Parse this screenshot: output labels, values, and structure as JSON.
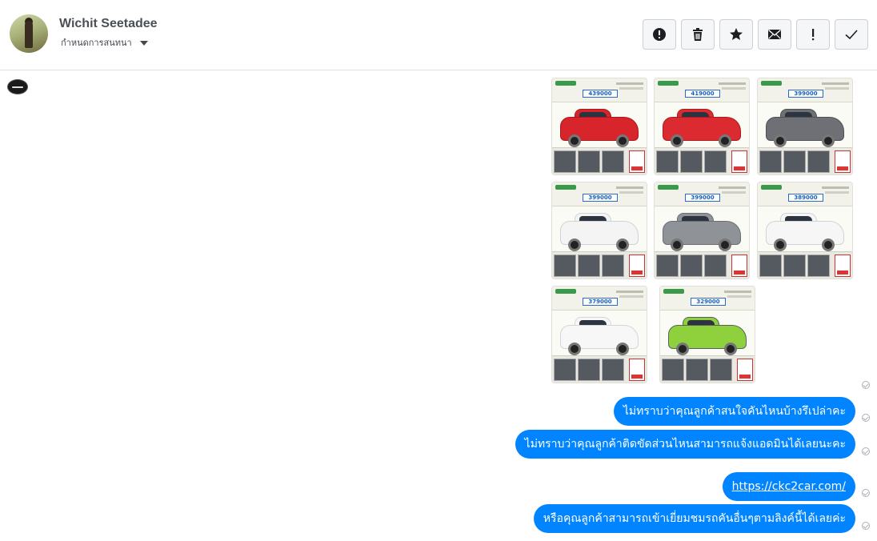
{
  "header": {
    "contact_name": "Wichit Seetadee",
    "subtitle": "กำหนดการสนทนา",
    "actions": [
      {
        "name": "report-icon",
        "label": "report"
      },
      {
        "name": "trash-icon",
        "label": "delete"
      },
      {
        "name": "star-icon",
        "label": "star"
      },
      {
        "name": "envelope-icon",
        "label": "mark unread"
      },
      {
        "name": "exclamation-icon",
        "label": "spam"
      },
      {
        "name": "checkmark-icon",
        "label": "done"
      }
    ]
  },
  "gallery": {
    "cards": [
      {
        "price": "439000",
        "color": "#d8242b",
        "accent": "#a8181d"
      },
      {
        "price": "419000",
        "color": "#db2b30",
        "accent": "#a81c20"
      },
      {
        "price": "399000",
        "color": "#6e7075",
        "accent": "#4e5055"
      },
      {
        "price": "399000",
        "color": "#f4f4f4",
        "accent": "#cfd2d6"
      },
      {
        "price": "399000",
        "color": "#8f9296",
        "accent": "#6a6d71"
      },
      {
        "price": "389000",
        "color": "#f6f6f6",
        "accent": "#d0d3d7"
      },
      {
        "price": "379000",
        "color": "#f7f7f7",
        "accent": "#d3d6da"
      },
      {
        "price": "329000",
        "color": "#8ed13c",
        "accent": "#5a5f63"
      }
    ]
  },
  "messages": [
    {
      "text": "ไม่ทราบว่าคุณลูกค้าสนใจคันไหนบ้างรึเปล่าคะ"
    },
    {
      "text": "ไม่ทราบว่าคุณลูกค้าติดขัดส่วนไหนสามารถแจ้งแอดมินได้เลยนะคะ"
    },
    {
      "text": "https://ckc2car.com/",
      "is_link": true
    },
    {
      "text": "หรือคุณลูกค้าสามารถเข้าเยี่ยมชมรถคันอื่นๆตามลิงค์นี้ได้เลยค่ะ"
    }
  ],
  "colors": {
    "bubble": "#0084ff",
    "border": "#dddfe2"
  }
}
